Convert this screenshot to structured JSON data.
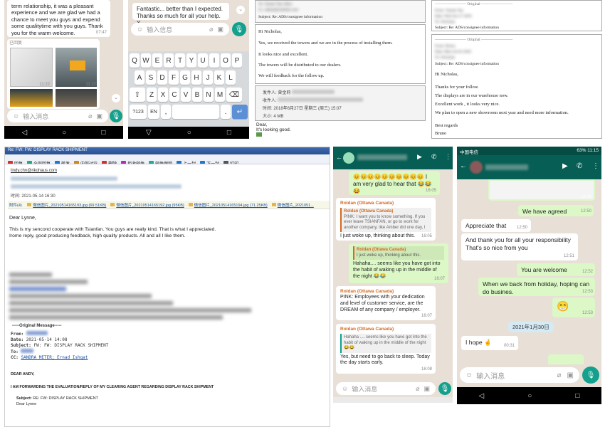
{
  "panel1": {
    "msg1": "term relationship, it was a pleasant experience and we are glad we had a chance to meet you guys and expend some qualitytime with you guys. Thank you for the warm welcome.",
    "msg1_time": "07:47",
    "file_label": "已回复",
    "thumb_time1": "11:22",
    "thumb_time2": "11:22",
    "input_placeholder": "输入消息"
  },
  "panel2": {
    "msg": "Fantastic... better than I expected. Thanks so much for all your help. X",
    "input_placeholder": "输入信息",
    "keys_row1": [
      "Q",
      "W",
      "E",
      "R",
      "T",
      "Y",
      "U",
      "I",
      "O",
      "P"
    ],
    "keys_row2": [
      "A",
      "S",
      "D",
      "F",
      "G",
      "H",
      "J",
      "K",
      "L"
    ],
    "keys_row3": [
      "Z",
      "X",
      "C",
      "V",
      "B",
      "N",
      "M"
    ],
    "key_sym": "?123",
    "key_lang": "EN",
    "key_comma": ",",
    "key_period": ".",
    "key_enter": "↵"
  },
  "panel3": {
    "to_label": "To:",
    "cc_label": "Cc:",
    "subject": "Subject: Re: ADS/consignee information",
    "greeting": "Hi Nicholas,",
    "line1": "Yes, we received the towers and we are in the process of installing them.",
    "line2": "It looks nice and excellent.",
    "line3": "The towers will be distributed to our dealers.",
    "line4": "We will feedback for the follow up.",
    "sender_label": "发件人:",
    "sender_name": "曾金莉",
    "recipient_label": "收件人:",
    "time_label": "时间:",
    "time_value": "2018年6月27日 星期三 (周三) 15:07",
    "size_label": "大小:",
    "size_value": "4 MB",
    "dear": "Dear,",
    "body": "It's looking good."
  },
  "panel4": {
    "original1": "Original",
    "original2": "Original",
    "subject1": "Subject: Re: ADS/consignee information",
    "subject2": "Subject: Re: ADS/consignee information",
    "greeting": "Hi Nicholas,",
    "line1": "Thanks for your follow.",
    "line2": "The displays are in our warehouse now.",
    "line3": "Excellent work , it looks very nice.",
    "line4": "We plan to open a new showroom next year and need more information.",
    "regards": "Best regards",
    "sign": "Bruno"
  },
  "panel5": {
    "window_title": "Re: FW: FW: DISPLAY RACK SHIPMENT",
    "toolbar": [
      "回复",
      "全部回复",
      "转发",
      "内部讨论",
      "删除",
      "拒收邮件",
      "邮件跟踪",
      "上一封",
      "下一封",
      "打印"
    ],
    "from_email": "lindy.chn@rikohaus.com",
    "attach_label": "附件(4)",
    "attachments": [
      "微信图片_20210514165193.jpg (69.51KB)",
      "微信图片_20210514165192.jpg (95KB)",
      "微信图片_20210514165194.jpg (71.25KB)",
      "微信图片_2021051..."
    ],
    "time_label": "时间:",
    "time_value": "2021-05-14  16:30",
    "dear": "Dear Lynne,",
    "body1": "This is my sencond cooperate with Tsianfan. You guys are really kind. That is what I appreciated.",
    "body2": "Irome reply, good producing feedback, high quality products. All and all I like them.",
    "orig_header": "-----Original Message-----",
    "orig_from_label": "From:",
    "orig_date_label": "Date:",
    "orig_date_value": "2021-05-14 14:08",
    "orig_subject_label": "Subject:",
    "orig_subject_value": "FW: FW: DISPLAY RACK SHIPMENT",
    "orig_to_label": "To:",
    "orig_cc_label": "CC:",
    "orig_cc_value": "SANDRA METER; Ernad Ishqat",
    "dear_andy": "DEAR ANDY,",
    "forwarding": "I AM FORWARDING THE EVALUATION/REPLY OF MY CLEARING AGENT REGARDING DISPLAY RACK SHIPMENT",
    "sub2_label": "Subject:",
    "sub2_value": "RE: FW: DISPLAY RACK SHIPMENT",
    "dear_lynne": "Dear Lynne"
  },
  "panel6": {
    "msg_top": "😊😊😊😊😊😊😊😊😊😊 I am very glad to hear that 😂😂😂",
    "msg_top_time": "16:05",
    "sender_name": "Roldan (Ottawa Canada)",
    "quote1_name": "Roldan (Ottawa Canada)",
    "quote1": "PINK: I want you to know something. If you ever leave TSIANFAN, or go to work for another company, like Amber did one day, I",
    "reply1": "I just woke up, thinking about this.",
    "reply1_time": "16:05",
    "quote2_name": "Roldan (Ottawa Canada)",
    "quote2": "I just woke up, thinking about this.",
    "msg_out": "Hahaha.... seems like you have got into the habit of waking up in the middle of the night 😂😂",
    "msg_out_time": "16:07",
    "msg3_name": "Roldan (Ottawa Canada)",
    "msg3": "PINK:  Employees with your dedication and level of customer service, are the DREAM of any company / employer.",
    "msg3_time": "16:07",
    "msg4_name": "Roldan (Ottawa Canada)",
    "quote3": "Hahaha .... seems like you have got into the habit of waking up in the middle of the night 😂😂",
    "msg4": "Yes, but need to go back to sleep. Today the day starts early.",
    "msg4_time": "16:08",
    "input_placeholder": "输入消息"
  },
  "panel7": {
    "carrier": "中国电信",
    "status_right": "63% 11:15",
    "img_time": "12:49",
    "msg1": "We have agreed",
    "msg1_time": "12:50",
    "msg2": "Appreciate that",
    "msg2_time": "12:50",
    "msg3": "And thank you for all your responsibility That's so nice from you",
    "msg3_time": "12:51",
    "msg4": "You are welcome",
    "msg4_time": "12:52",
    "msg5": "When we back from holiday, hoping can do busines.",
    "msg5_time": "12:53",
    "emoji": "😁",
    "emoji_time": "12:53",
    "date_chip": "2021年1月30日",
    "msg6": "I hope 🤞",
    "msg6_time": "00:31",
    "input_placeholder": "输入消息"
  },
  "colors": {
    "wa_green": "#13a08d",
    "wa_header": "#075e54",
    "bubble_out": "#dcf8c6",
    "wa_bg": "#e8dfd6"
  }
}
